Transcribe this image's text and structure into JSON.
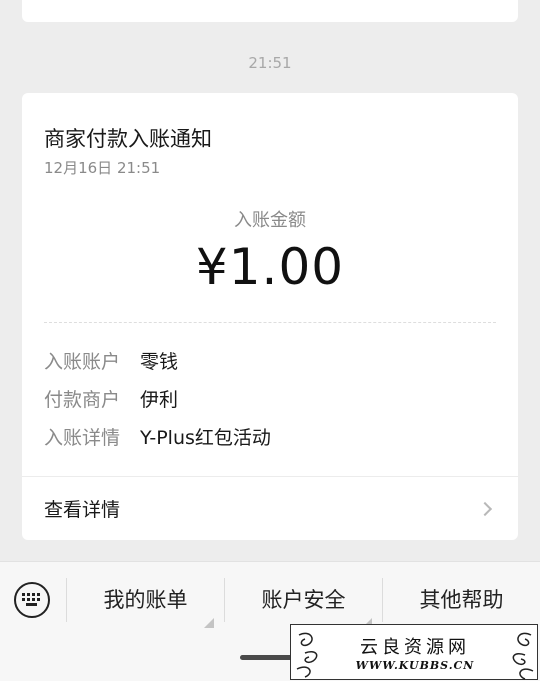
{
  "chat": {
    "timestamp": "21:51"
  },
  "card": {
    "title": "商家付款入账通知",
    "date": "12月16日  21:51",
    "amount_label": "入账金额",
    "amount_value": "¥1.00",
    "rows": [
      {
        "key": "入账账户",
        "value": "零钱"
      },
      {
        "key": "付款商户",
        "value": "伊利"
      },
      {
        "key": "入账详情",
        "value": "Y-Plus红包活动"
      }
    ],
    "detail_label": "查看详情"
  },
  "bottom_menu": {
    "items": [
      "我的账单",
      "账户安全",
      "其他帮助"
    ]
  },
  "watermark": {
    "title": "云良资源网",
    "url": "WWW.KUBBS.CN"
  }
}
